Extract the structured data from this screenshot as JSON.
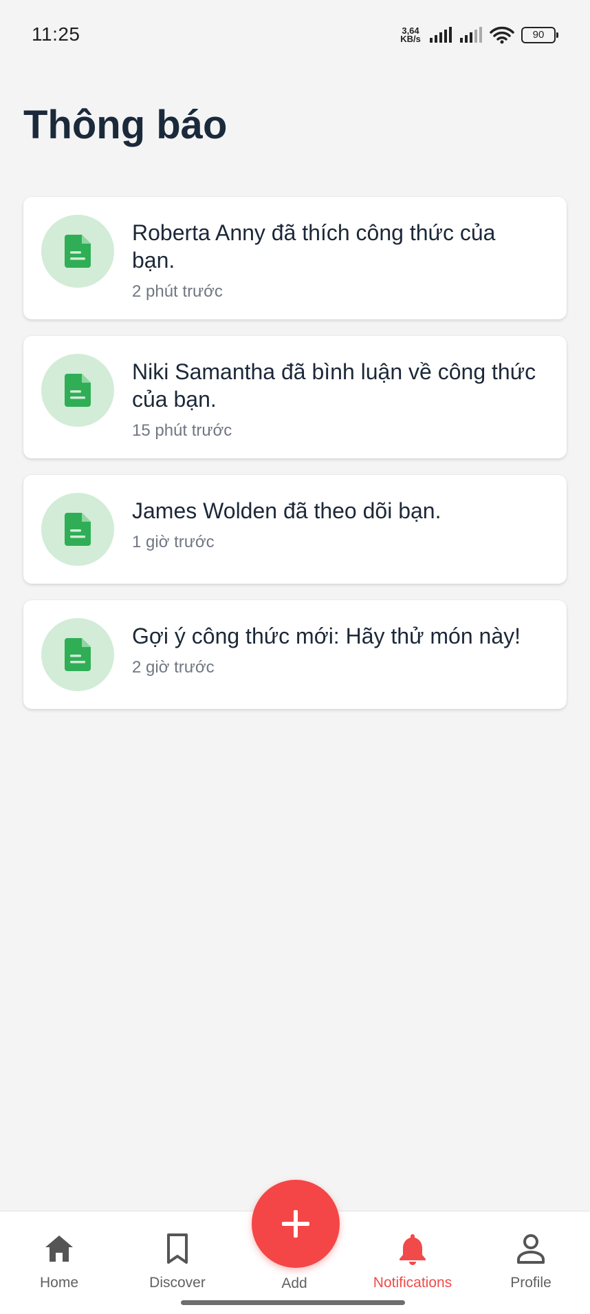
{
  "status_bar": {
    "time": "11:25",
    "net_speed_value": "3,64",
    "net_speed_unit": "KB/s",
    "battery": "90"
  },
  "page": {
    "title": "Thông báo"
  },
  "notifications": [
    {
      "message": "Roberta Anny đã thích công thức của bạn.",
      "time": "2 phút trước",
      "icon": "document-icon"
    },
    {
      "message": "Niki Samantha đã bình luận về công thức của bạn.",
      "time": "15 phút trước",
      "icon": "document-icon"
    },
    {
      "message": "James Wolden đã theo dõi bạn.",
      "time": "1 giờ trước",
      "icon": "document-icon"
    },
    {
      "message": "Gợi ý công thức mới: Hãy thử món này!",
      "time": "2 giờ trước",
      "icon": "document-icon"
    }
  ],
  "bottom_nav": {
    "home": "Home",
    "discover": "Discover",
    "add": "Add",
    "notifications": "Notifications",
    "profile": "Profile"
  },
  "colors": {
    "accent": "#f44646",
    "icon_green": "#2fae56",
    "icon_bg": "#d2ecd7",
    "title": "#1b2a3b"
  }
}
